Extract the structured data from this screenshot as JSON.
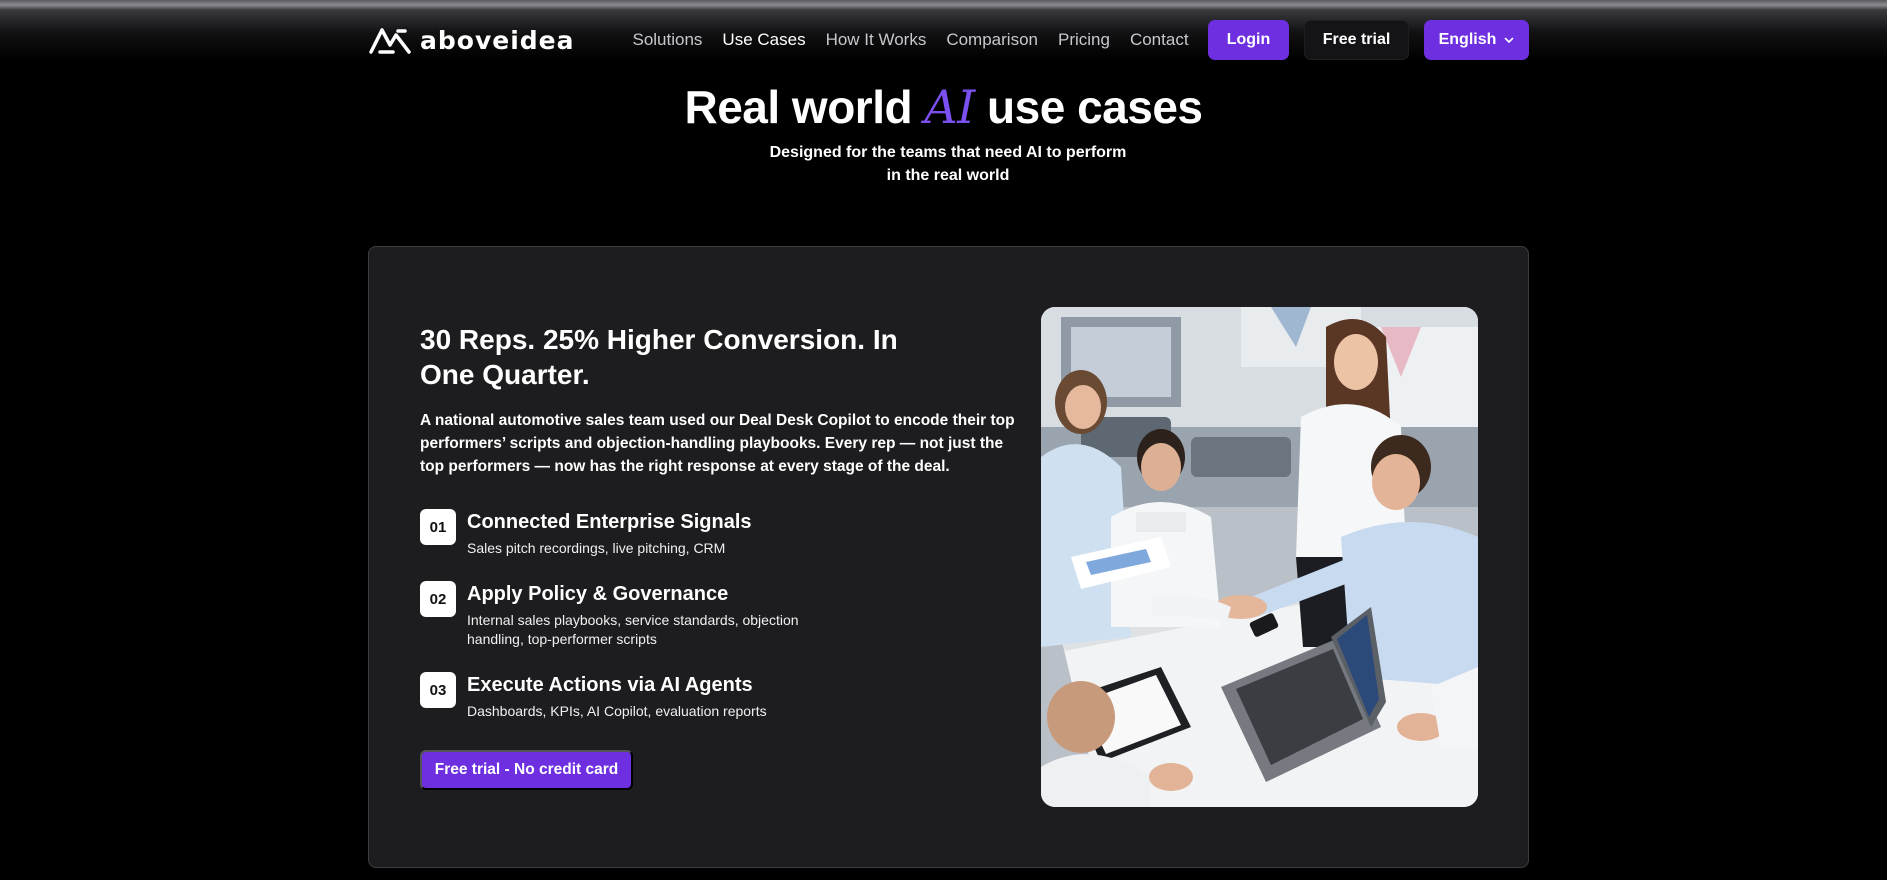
{
  "brand": {
    "name": "aboveidea",
    "logo_icon": "aboveidea-logo-icon"
  },
  "nav": {
    "items": [
      {
        "label": "Solutions",
        "active": false
      },
      {
        "label": "Use Cases",
        "active": true
      },
      {
        "label": "How It Works",
        "active": false
      },
      {
        "label": "Comparison",
        "active": false
      },
      {
        "label": "Pricing",
        "active": false
      },
      {
        "label": "Contact",
        "active": false
      }
    ],
    "login_label": "Login",
    "free_trial_label": "Free trial",
    "language_label": "English",
    "language_icon": "chevron-down-icon"
  },
  "hero": {
    "title_before": "Real world ",
    "title_ai": "AI",
    "title_after": " use cases",
    "subtitle": "Designed for the teams that need AI to perform in the real world"
  },
  "case": {
    "title": "30 Reps. 25% Higher Conversion. In One Quarter.",
    "description": "A national automotive sales team used our Deal Desk Copilot to encode their top performers’ scripts and objection-handling playbooks. Every rep — not just the top performers — now has the right response at every stage of the deal.",
    "steps": [
      {
        "num": "01",
        "title": "Connected Enterprise Signals",
        "desc": "Sales pitch recordings, live pitching, CRM"
      },
      {
        "num": "02",
        "title": "Apply Policy & Governance",
        "desc": "Internal sales playbooks, service standards, objection handling, top-performer scripts"
      },
      {
        "num": "03",
        "title": "Execute Actions via AI Agents",
        "desc": "Dashboards, KPIs, AI Copilot, evaluation reports"
      }
    ],
    "cta_label": "Free trial - No credit card"
  },
  "colors": {
    "accent": "#6d2fe0",
    "ai_highlight": "#7b4ff0",
    "card_bg": "#1d1d20",
    "page_bg": "#000000"
  }
}
